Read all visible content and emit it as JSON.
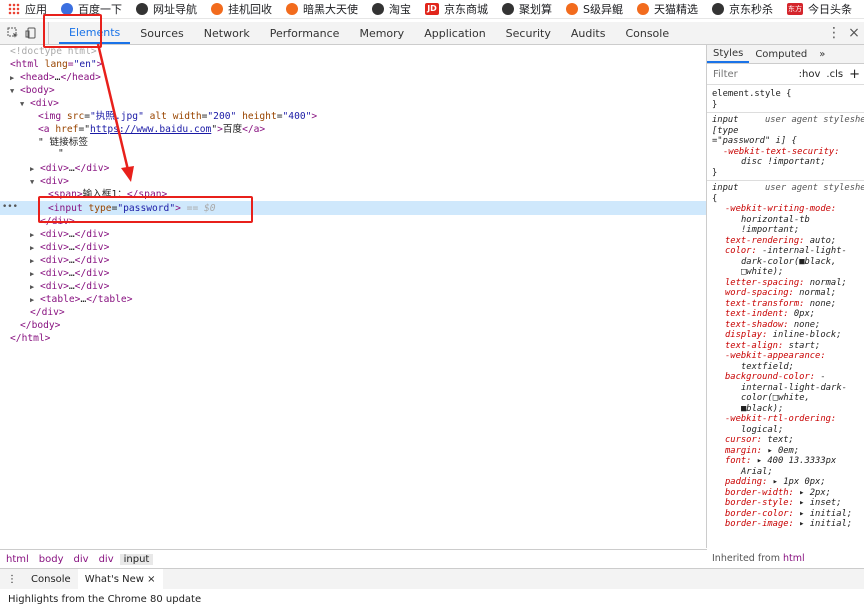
{
  "bookmarks": [
    {
      "label": "应用",
      "icon": "apps-grid-icon"
    },
    {
      "label": "百度一下",
      "icon": "baidu-paw-icon"
    },
    {
      "label": "网址导航",
      "icon": "globe-icon"
    },
    {
      "label": "挂机回收",
      "icon": "fire-icon"
    },
    {
      "label": "暗黑大天使",
      "icon": "fire-icon"
    },
    {
      "label": "淘宝",
      "icon": "globe-icon"
    },
    {
      "label": "京东商城",
      "icon": "jd-icon",
      "badge": "JD"
    },
    {
      "label": "聚划算",
      "icon": "globe-icon"
    },
    {
      "label": "S级异鲲",
      "icon": "fire-icon"
    },
    {
      "label": "天猫精选",
      "icon": "fire-icon"
    },
    {
      "label": "京东秒杀",
      "icon": "globe-icon"
    },
    {
      "label": "今日头条",
      "icon": "dongfang-icon",
      "badge": "东方"
    }
  ],
  "toolbar": {
    "tabs": [
      "Elements",
      "Sources",
      "Network",
      "Performance",
      "Memory",
      "Application",
      "Security",
      "Audits",
      "Console"
    ],
    "active_tab": "Elements"
  },
  "dom": {
    "doctype": "<!doctype html>",
    "html_open_tag": "html",
    "html_attr": "lang",
    "html_attr_val": "\"en\"",
    "head": "head",
    "body": "body",
    "div": "div",
    "img_tag": "img",
    "img_src_attr": "src",
    "img_src_val": "\"执照.jpg\"",
    "img_alt_attr": "alt",
    "img_width_attr": "width",
    "img_width_val": "\"200\"",
    "img_height_attr": "height",
    "img_height_val": "\"400\"",
    "a_tag": "a",
    "a_href_attr": "href",
    "a_href_val": "https://www.baidu.com",
    "a_text": "百度",
    "text_node": "\" 链接标签",
    "text_node_tail": "\"",
    "span_tag": "span",
    "span_text": "输入框1：",
    "input_tag": "input",
    "input_type_attr": "type",
    "input_type_val": "\"password\"",
    "dollar": "== $0",
    "table_tag": "table",
    "ellipsis": "…"
  },
  "styles_pane": {
    "tabs": [
      "Styles",
      "Computed"
    ],
    "more": "»",
    "filter_placeholder": "Filter",
    "hov": ":hov",
    "cls": ".cls",
    "plus": "+",
    "element_style": "element.style {",
    "close_brace": "}",
    "rule1_selector": "input",
    "rule1_origin": "user agent stylesheet",
    "rule1_selector_2": "[type",
    "rule1_selector_3": "=\"password\" i] {",
    "rule1_prop": "-webkit-text-security:",
    "rule1_val": "disc !important;",
    "rule2_selector": "input",
    "rule2_origin": "user agent stylesheet",
    "rule2_open": "{",
    "props": [
      {
        "p": "-webkit-writing-mode:",
        "v": ""
      },
      {
        "p": "",
        "v": "horizontal-tb"
      },
      {
        "p": "",
        "v": "!important;"
      },
      {
        "p": "text-rendering:",
        "v": "auto;"
      },
      {
        "p": "color:",
        "v": "-internal-light-"
      },
      {
        "p": "",
        "v": "dark-color(■black,"
      },
      {
        "p": "",
        "v": "□white);"
      },
      {
        "p": "letter-spacing:",
        "v": "normal;"
      },
      {
        "p": "word-spacing:",
        "v": "normal;"
      },
      {
        "p": "text-transform:",
        "v": "none;"
      },
      {
        "p": "text-indent:",
        "v": "0px;"
      },
      {
        "p": "text-shadow:",
        "v": "none;"
      },
      {
        "p": "display:",
        "v": "inline-block;"
      },
      {
        "p": "text-align:",
        "v": "start;"
      },
      {
        "p": "-webkit-appearance:",
        "v": ""
      },
      {
        "p": "",
        "v": "textfield;"
      },
      {
        "p": "background-color:",
        "v": "-"
      },
      {
        "p": "",
        "v": "internal-light-dark-"
      },
      {
        "p": "",
        "v": "color(□white,"
      },
      {
        "p": "",
        "v": "■black);"
      },
      {
        "p": "-webkit-rtl-ordering:",
        "v": ""
      },
      {
        "p": "",
        "v": "logical;"
      },
      {
        "p": "cursor:",
        "v": "text;"
      },
      {
        "p": "margin:",
        "v": "▸ 0em;"
      },
      {
        "p": "font:",
        "v": "▸ 400 13.3333px"
      },
      {
        "p": "",
        "v": "Arial;"
      },
      {
        "p": "padding:",
        "v": "▸ 1px 0px;"
      },
      {
        "p": "border-width:",
        "v": "▸ 2px;"
      },
      {
        "p": "border-style:",
        "v": "▸ inset;"
      },
      {
        "p": "border-color:",
        "v": "▸ initial;"
      },
      {
        "p": "border-image:",
        "v": "▸ initial;"
      }
    ],
    "inherited_label": "Inherited from",
    "inherited_from": "html"
  },
  "breadcrumb": [
    "html",
    "body",
    "div",
    "div",
    "input"
  ],
  "drawer": {
    "tabs": [
      "Console",
      "What's New"
    ],
    "close": "×",
    "highlight_text": "Highlights from the Chrome 80 update"
  },
  "colors": {
    "accent": "#1a73e8",
    "annotation_red": "#e8201b",
    "selection": "#cfe8fc"
  }
}
